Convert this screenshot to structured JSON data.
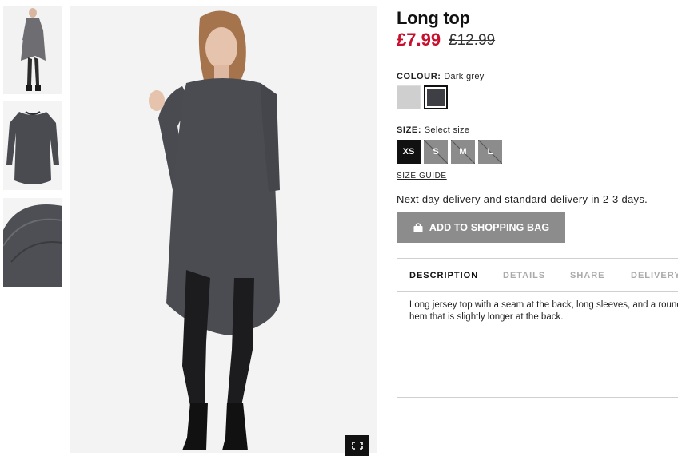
{
  "product": {
    "title": "Long top",
    "price_current": "£7.99",
    "price_original": "£12.99"
  },
  "colour": {
    "label": "COLOUR:",
    "selected": "Dark grey",
    "swatches": [
      {
        "name": "light grey",
        "hex": "#cfcfcf"
      },
      {
        "name": "Dark grey",
        "hex": "#3d3f44"
      }
    ]
  },
  "size": {
    "label": "SIZE:",
    "prompt": "Select size",
    "options": [
      "XS",
      "S",
      "M",
      "L"
    ],
    "available": [
      true,
      false,
      false,
      false
    ]
  },
  "size_guide_label": "SIZE GUIDE",
  "delivery_text": "Next day delivery and standard delivery in 2-3 days.",
  "add_to_bag_label": "ADD TO SHOPPING BAG",
  "tabs": [
    "DESCRIPTION",
    "DETAILS",
    "SHARE",
    "DELIVERY"
  ],
  "description_text": "Long jersey top with a seam at the back, long sleeves, and a rounded hem that is slightly longer at the back.",
  "icons": {
    "bag": "shopping-bag-icon",
    "fullscreen": "fullscreen-icon"
  },
  "colors": {
    "price_red": "#c8102e",
    "button_grey": "#8c8c8c",
    "selected_black": "#111111"
  }
}
